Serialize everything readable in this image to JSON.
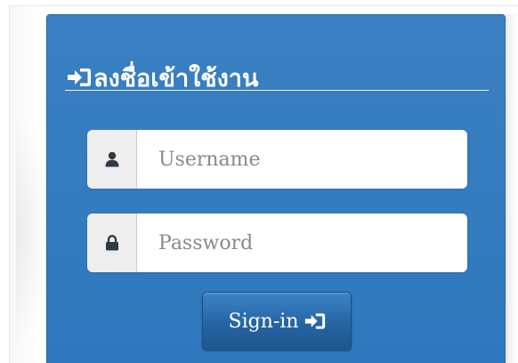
{
  "login": {
    "heading": "ลงชื่อเข้าใช้งาน",
    "heading_icon": "sign-in-icon",
    "username": {
      "icon": "user-icon",
      "placeholder": "Username",
      "value": ""
    },
    "password": {
      "icon": "lock-icon",
      "placeholder": "Password",
      "value": ""
    },
    "submit": {
      "label": "Sign-in",
      "icon": "sign-in-icon"
    }
  },
  "colors": {
    "panel": "#3078bc",
    "button": "#2462a0",
    "addon": "#eeeeee",
    "icon": "#2f3a45"
  }
}
